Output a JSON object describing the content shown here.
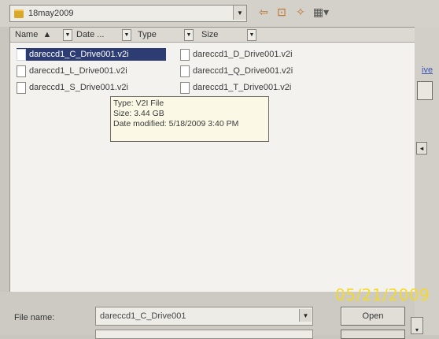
{
  "toolbar": {
    "look_in": "18may2009",
    "icons": [
      "folder-icon",
      "back-arrow-icon",
      "up-folder-icon",
      "new-folder-icon",
      "view-menu-icon"
    ]
  },
  "columns": {
    "name": "Name",
    "date": "Date ...",
    "type": "Type",
    "size": "Size"
  },
  "files": [
    "dareccd1_C_Drive001.v2i",
    "dareccd1_L_Drive001.v2i",
    "dareccd1_S_Drive001.v2i",
    "dareccd1_D_Drive001.v2i",
    "dareccd1_Q_Drive001.v2i",
    "dareccd1_T_Drive001.v2i"
  ],
  "tooltip": {
    "type": "Type: V2I File",
    "size": "Size: 3.44 GB",
    "date": "Date modified: 5/18/2009 3:40 PM"
  },
  "right": {
    "link": "ive"
  },
  "footer": {
    "file_name_label": "File name:",
    "file_name_value": "dareccd1_C_Drive001",
    "open_button": "Open"
  },
  "camera_stamp": "05/21/2009",
  "colors": {
    "selection": "#2d3d73",
    "tooltip_bg": "#fbf9e6",
    "stamp": "#f3d92a"
  }
}
